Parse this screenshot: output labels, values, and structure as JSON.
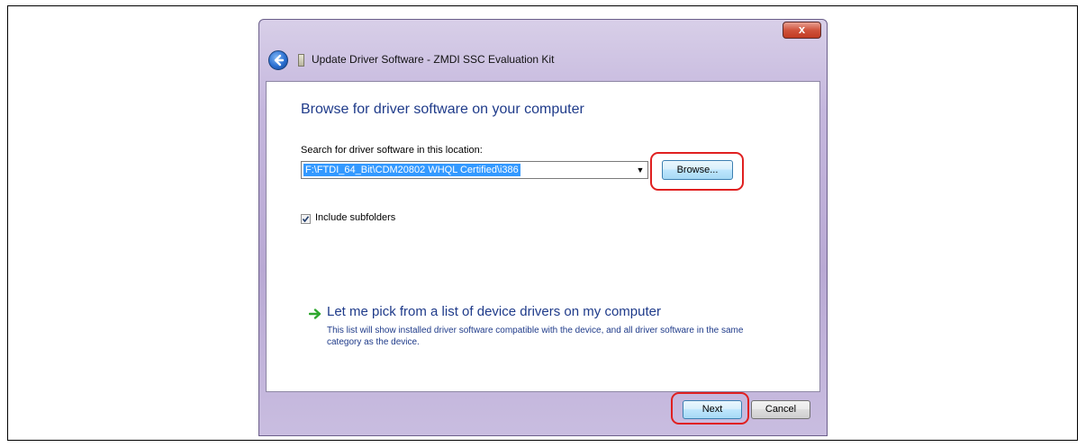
{
  "window": {
    "title": "Update Driver Software - ZMDI SSC Evaluation Kit",
    "close_label": "x"
  },
  "content": {
    "heading": "Browse for driver software on your computer",
    "search_label": "Search for driver software in this location:",
    "path_value": "F:\\FTDI_64_Bit\\CDM20802 WHQL Certified\\i386",
    "browse_label": "Browse...",
    "include_subfolders_label": "Include subfolders",
    "include_subfolders_checked": true,
    "pick_link": "Let me pick from a list of device drivers on my computer",
    "pick_description": "This list will show installed driver software compatible with the device, and all driver software in the same category as the device."
  },
  "footer": {
    "next_label": "Next",
    "cancel_label": "Cancel"
  },
  "colors": {
    "heading": "#1f3b8a",
    "highlight": "#e02020",
    "selection": "#3399ff",
    "arrow": "#2fa82f"
  },
  "icons": {
    "back": "back-arrow-icon",
    "device": "device-icon",
    "checkbox": "checkmark-icon",
    "link": "green-arrow-icon"
  }
}
